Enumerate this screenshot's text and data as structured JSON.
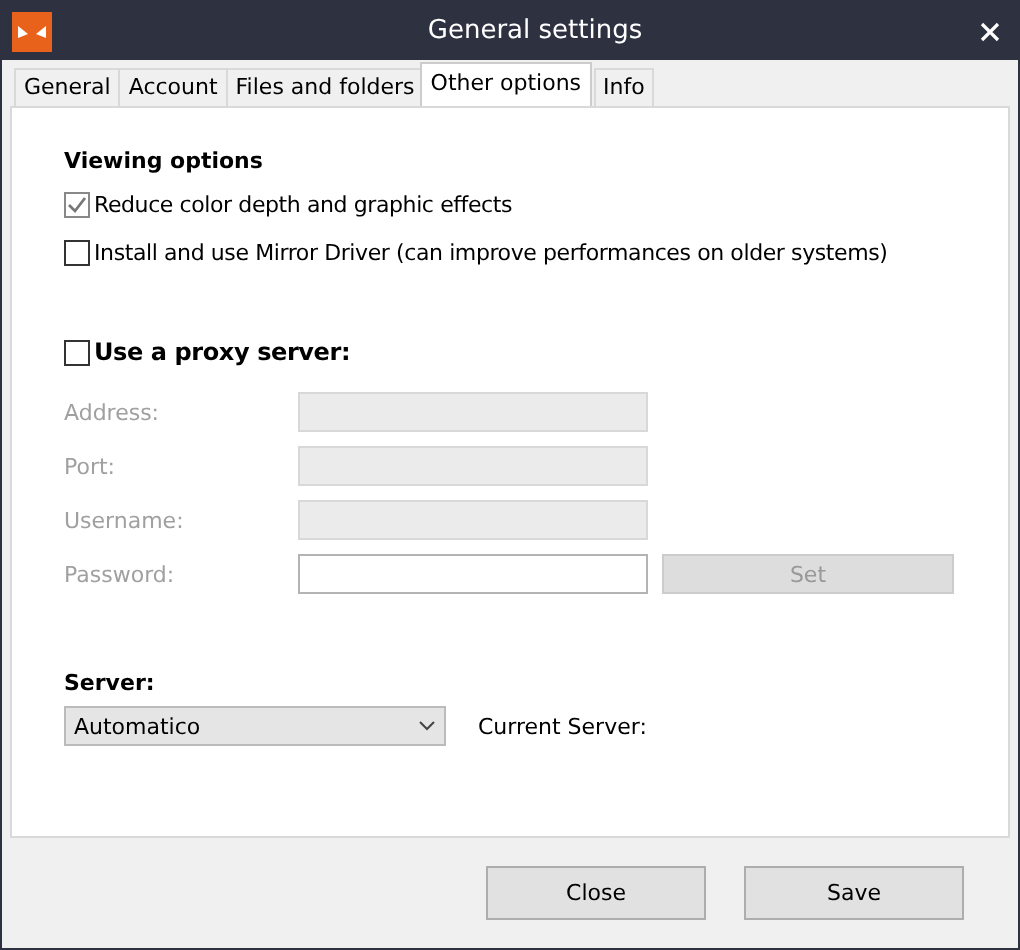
{
  "window": {
    "title": "General settings"
  },
  "tabs": [
    {
      "label": "General",
      "selected": false
    },
    {
      "label": "Account",
      "selected": false
    },
    {
      "label": "Files and folders",
      "selected": false
    },
    {
      "label": "Other options",
      "selected": true
    },
    {
      "label": "Info",
      "selected": false
    }
  ],
  "viewing_options": {
    "heading": "Viewing options",
    "options": [
      {
        "label": "Reduce color depth and graphic effects",
        "checked": true,
        "disabled": true
      },
      {
        "label": "Install and use Mirror Driver (can improve performances on older systems)",
        "checked": false,
        "disabled": false
      }
    ]
  },
  "proxy": {
    "label": "Use a proxy server:",
    "checked": false,
    "fields": [
      {
        "label": "Address:",
        "disabled": true
      },
      {
        "label": "Port:",
        "disabled": true
      },
      {
        "label": "Username:",
        "disabled": true
      },
      {
        "label": "Password:",
        "disabled": false
      }
    ],
    "set_button": {
      "label": "Set",
      "disabled": true
    }
  },
  "server": {
    "heading": "Server:",
    "value": "Automatico",
    "current_label": "Current Server:"
  },
  "buttons": [
    "Close",
    "Save"
  ]
}
